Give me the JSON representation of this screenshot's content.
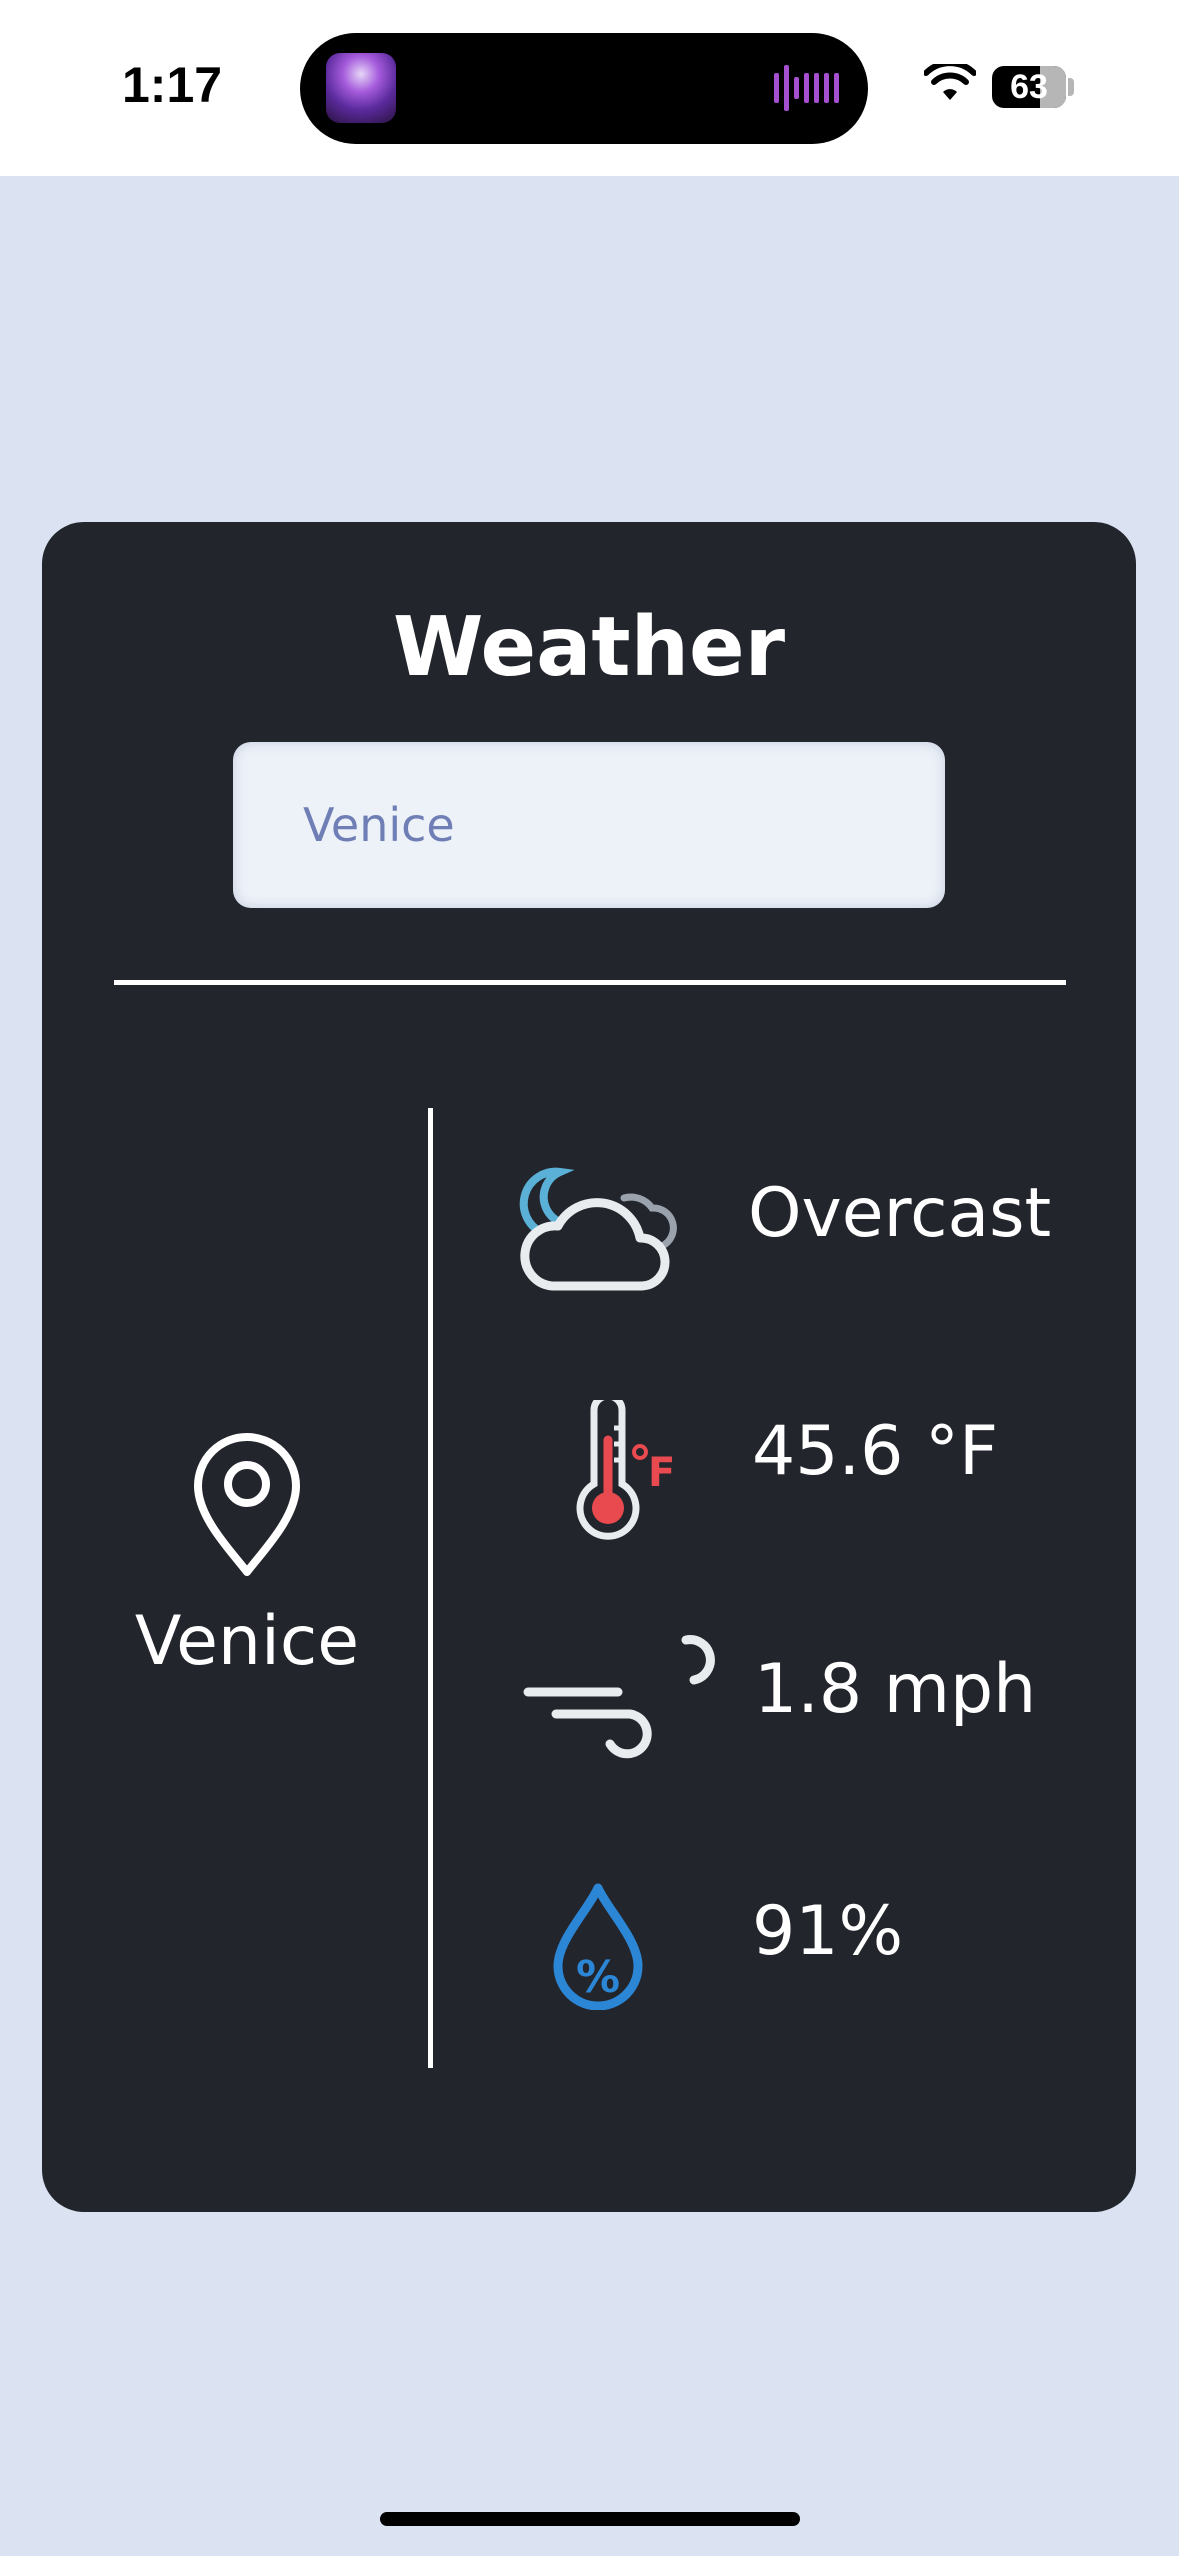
{
  "status_bar": {
    "time": "1:17",
    "battery": "63",
    "icons": [
      "now-playing-art",
      "audio-waveform-icon",
      "wifi-icon",
      "battery-icon"
    ]
  },
  "card": {
    "title": "Weather",
    "search": {
      "value": "Venice",
      "placeholder": "Venice"
    },
    "location": {
      "name": "Venice",
      "icon": "location-pin-icon"
    },
    "conditions": [
      {
        "icon": "cloud-moon-icon",
        "value": "Overcast"
      },
      {
        "icon": "thermometer-fahrenheit-icon",
        "value": "45.6 °F"
      },
      {
        "icon": "wind-icon",
        "value": "1.8 mph"
      },
      {
        "icon": "humidity-drop-icon",
        "value": "91%"
      }
    ]
  },
  "colors": {
    "page_background": "#dbe3f2",
    "card_background": "#22252b",
    "input_background": "#edf1f8",
    "input_text": "#6f7fb6",
    "thermometer_accent": "#e84a4f",
    "humidity_accent": "#2c86d6",
    "moon_accent": "#5ab0d6"
  }
}
